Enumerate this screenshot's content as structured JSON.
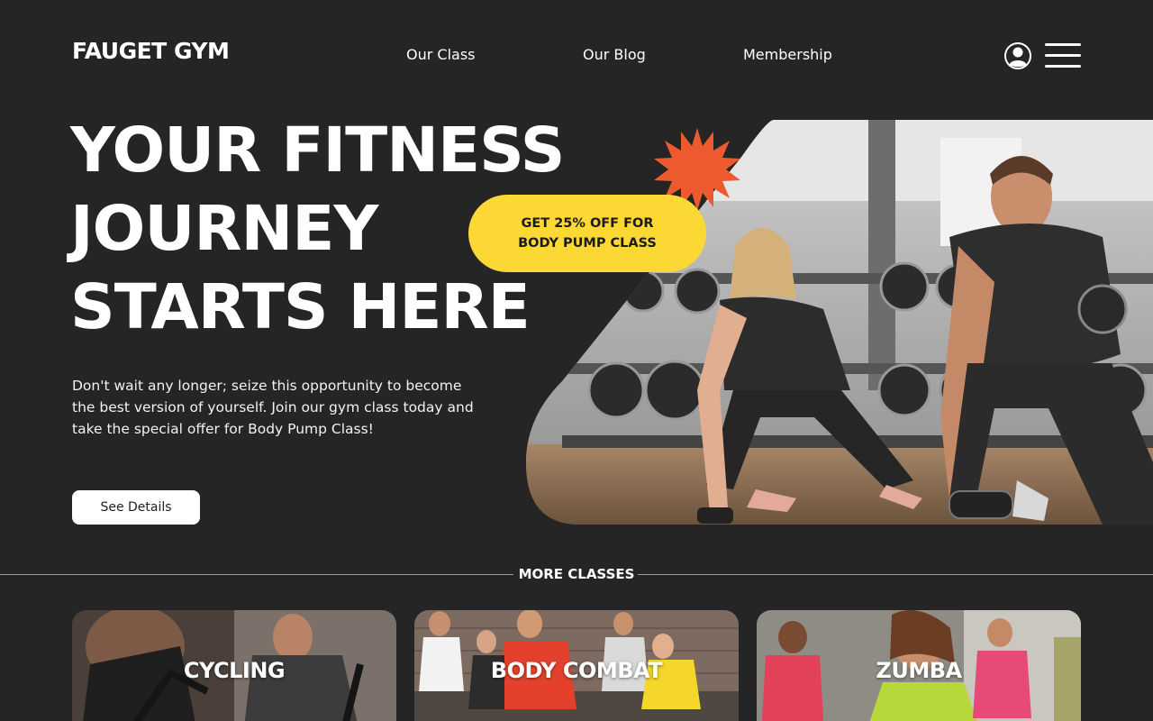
{
  "header": {
    "logo": "FAUGET GYM",
    "nav": [
      "Our Class",
      "Our Blog",
      "Membership"
    ],
    "icons": {
      "user": "user-circle-icon",
      "menu": "hamburger-menu-icon"
    }
  },
  "hero": {
    "title_lines": [
      "YOUR FITNESS",
      "JOURNEY",
      "STARTS HERE"
    ],
    "description": "Don't wait any longer; seize this opportunity to become the best version of yourself. Join our gym class today and take the special offer for Body Pump Class!",
    "button": "See Details",
    "promo_lines": [
      "GET 25% OFF FOR",
      "BODY PUMP CLASS"
    ]
  },
  "more_classes": {
    "title": "MORE CLASSES",
    "cards": [
      "CYCLING",
      "BODY COMBAT",
      "ZUMBA"
    ]
  },
  "colors": {
    "background": "#252525",
    "accent_yellow": "#fcd834",
    "accent_orange": "#ee5a2f"
  }
}
